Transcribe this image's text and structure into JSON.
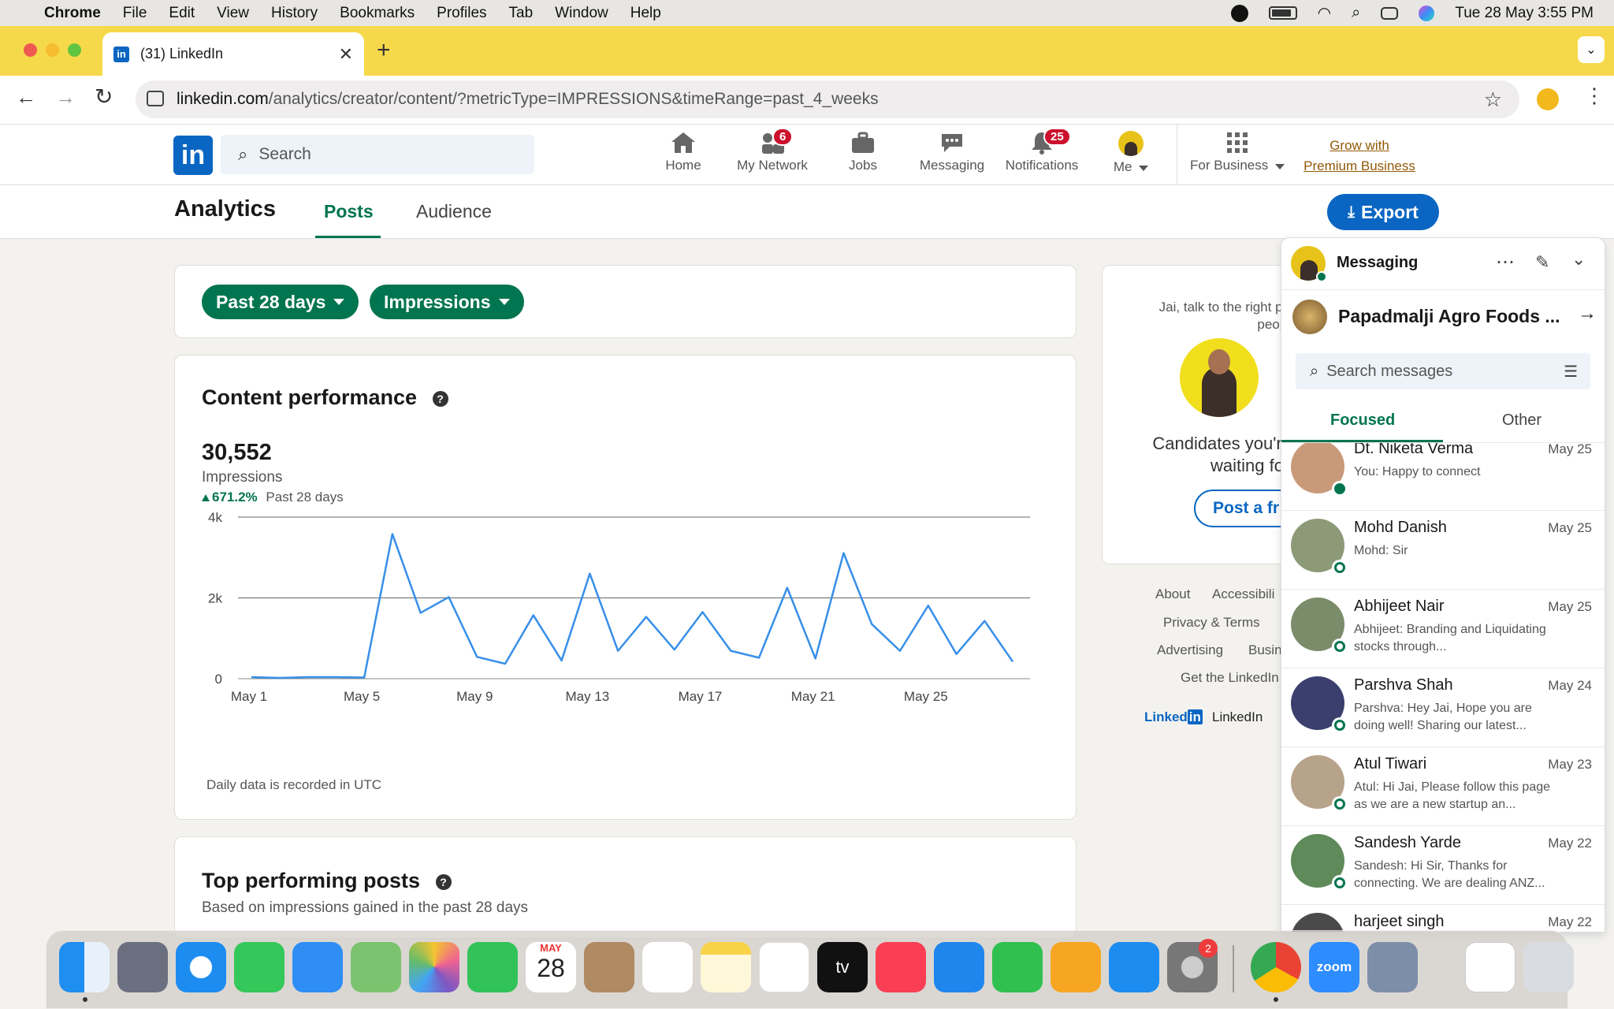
{
  "menubar": {
    "app": "Chrome",
    "items": [
      "File",
      "Edit",
      "View",
      "History",
      "Bookmarks",
      "Profiles",
      "Tab",
      "Window",
      "Help"
    ],
    "clock": "Tue 28 May  3:55 PM"
  },
  "browser": {
    "tab_title": "(31) LinkedIn",
    "url_host": "linkedin.com",
    "url_path": "/analytics/creator/content/?metricType=IMPRESSIONS&timeRange=past_4_weeks"
  },
  "linkedin": {
    "search_placeholder": "Search",
    "nav": [
      {
        "label": "Home"
      },
      {
        "label": "My Network",
        "badge": "6"
      },
      {
        "label": "Jobs"
      },
      {
        "label": "Messaging"
      },
      {
        "label": "Notifications",
        "badge": "25"
      },
      {
        "label": "Me"
      }
    ],
    "for_business": "For Business",
    "premium_line1": "Grow with",
    "premium_line2": "Premium Business"
  },
  "analytics": {
    "title": "Analytics",
    "tabs": [
      "Posts",
      "Audience"
    ],
    "export_label": "Export",
    "filter_range": "Past 28 days",
    "filter_metric": "Impressions"
  },
  "performance": {
    "title": "Content performance",
    "value": "30,552",
    "metric": "Impressions",
    "change": "671.2%",
    "change_period": "Past 28 days",
    "footnote": "Daily data is recorded in UTC"
  },
  "chart_data": {
    "type": "line",
    "x": [
      "May 1",
      "May 2",
      "May 3",
      "May 4",
      "May 5",
      "May 6",
      "May 7",
      "May 8",
      "May 9",
      "May 10",
      "May 11",
      "May 12",
      "May 13",
      "May 14",
      "May 15",
      "May 16",
      "May 17",
      "May 18",
      "May 19",
      "May 20",
      "May 21",
      "May 22",
      "May 23",
      "May 24",
      "May 25",
      "May 26",
      "May 27",
      "May 28"
    ],
    "x_tick_labels": [
      "May 1",
      "May 5",
      "May 9",
      "May 13",
      "May 17",
      "May 21",
      "May 25"
    ],
    "y_tick_labels": [
      "4k",
      "2k",
      "0"
    ],
    "series": [
      {
        "values": [
          40,
          20,
          40,
          40,
          30,
          3580,
          1630,
          2020,
          540,
          370,
          1570,
          450,
          2600,
          690,
          1530,
          720,
          1650,
          690,
          520,
          2250,
          500,
          3110,
          1350,
          690,
          1810,
          610,
          1430,
          420
        ]
      }
    ],
    "ylim": [
      0,
      4000
    ],
    "grid": true,
    "color": "#378fe9"
  },
  "top_posts": {
    "title": "Top performing posts",
    "subtitle": "Based on impressions gained in the past 28 days"
  },
  "side_card": {
    "line1": "Jai, talk to the right pe",
    "line2": "peopl",
    "candidates1": "Candidates you're",
    "candidates2": "waiting fo",
    "button": "Post a fr"
  },
  "footer_links": [
    "About",
    "Accessibili",
    "Privacy & Terms",
    "Advertising",
    "Busin",
    "Get the LinkedIn",
    "LinkedIn Co"
  ],
  "messaging": {
    "title": "Messaging",
    "org": "Papadmalji Agro Foods ...",
    "search_placeholder": "Search messages",
    "tabs": [
      "Focused",
      "Other"
    ],
    "conversations": [
      {
        "name": "Dt. Niketa Verma",
        "date": "May 25",
        "preview": "You: Happy to connect",
        "color": "#c99a7a"
      },
      {
        "name": "Mohd Danish",
        "date": "May 25",
        "preview": "Mohd: Sir",
        "color": "#8d9a78"
      },
      {
        "name": "Abhijeet Nair",
        "date": "May 25",
        "preview": "Abhijeet: Branding and Liquidating stocks through...",
        "color": "#7a8c6a"
      },
      {
        "name": "Parshva Shah",
        "date": "May 24",
        "preview": "Parshva: Hey Jai, Hope you are doing well! Sharing our latest...",
        "color": "#3a3f6e"
      },
      {
        "name": "Atul Tiwari",
        "date": "May 23",
        "preview": "Atul: Hi Jai, Please follow this page as we are a new startup an...",
        "color": "#b7a28a"
      },
      {
        "name": "Sandesh Yarde",
        "date": "May 22",
        "preview": "Sandesh: Hi Sir, Thanks for connecting. We are dealing ANZ...",
        "color": "#5f8a5a"
      },
      {
        "name": "harjeet singh",
        "date": "May 22",
        "preview": "",
        "color": "#4a4a4a"
      }
    ]
  },
  "dock": {
    "calendar_month": "MAY",
    "calendar_day": "28",
    "settings_badge": "2",
    "zoom_label": "zoom",
    "tv_label": "tv"
  }
}
